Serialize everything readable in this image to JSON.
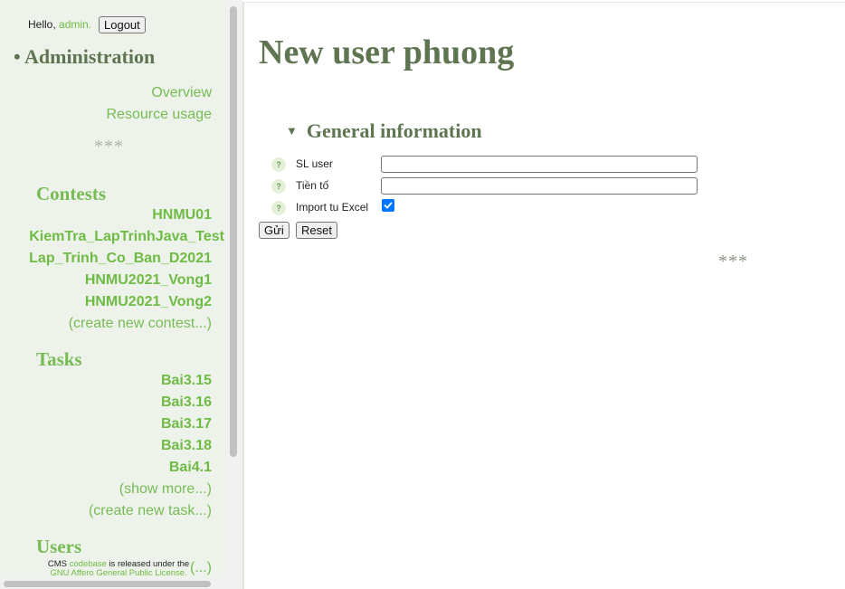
{
  "sidebar": {
    "hello_prefix": "Hello,",
    "username": "admin.",
    "logout_label": "Logout",
    "admin_title": "• Administration",
    "admin_links": [
      "Overview",
      "Resource usage"
    ],
    "separator": "***",
    "contests": {
      "title": "Contests",
      "items": [
        "HNMU01",
        "KiemTra_LapTrinhJava_Test",
        "Lap_Trinh_Co_Ban_D2021",
        "HNMU2021_Vong1",
        "HNMU2021_Vong2"
      ],
      "create_label": "(create new contest...)"
    },
    "tasks": {
      "title": "Tasks",
      "items": [
        "Bai3.15",
        "Bai3.16",
        "Bai3.17",
        "Bai3.18",
        "Bai4.1"
      ],
      "show_more_label": "(show more...)",
      "create_label": "(create new task...)"
    },
    "users": {
      "title": "Users",
      "partial_link": "(...)"
    },
    "footer": {
      "prefix": "CMS",
      "link": "codebase",
      "suffix": "is released under the",
      "license": "GNU Affero General Public License."
    }
  },
  "main": {
    "title": "New user phuong",
    "fieldset": {
      "toggle_glyph": "▼",
      "title": "General information"
    },
    "help_glyph": "?",
    "fields": [
      {
        "label": "SL user",
        "value": "",
        "type": "text"
      },
      {
        "label": "Tiền tố",
        "value": "",
        "type": "text"
      },
      {
        "label": "Import tu Excel",
        "checked": true,
        "type": "checkbox"
      }
    ],
    "submit_label": "Gửi",
    "reset_label": "Reset",
    "separator": "***"
  },
  "colors": {
    "sidebar_bg": "#edf3ea",
    "link_green": "#77bb55",
    "heading_green": "#5f7551",
    "checkbox_blue": "#0075ff"
  }
}
